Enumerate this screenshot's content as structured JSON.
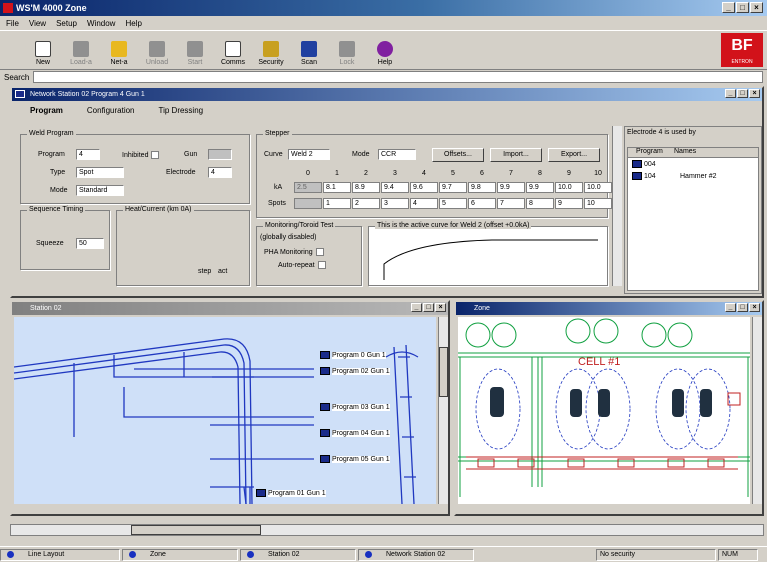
{
  "app": {
    "title": "WS'M 4000 Zone"
  },
  "menu": [
    "File",
    "View",
    "Setup",
    "Window",
    "Help"
  ],
  "toolbar": [
    {
      "label": "New",
      "enabled": true
    },
    {
      "label": "Load-a",
      "enabled": false
    },
    {
      "label": "Net-a",
      "enabled": true
    },
    {
      "label": "Unload",
      "enabled": false
    },
    {
      "label": "Start",
      "enabled": false
    },
    {
      "label": "Comms",
      "enabled": true
    },
    {
      "label": "Security",
      "enabled": true
    },
    {
      "label": "Scan",
      "enabled": true
    },
    {
      "label": "Lock",
      "enabled": false
    },
    {
      "label": "Help",
      "enabled": true
    }
  ],
  "logo": {
    "text": "BF",
    "sub": "ENTRON"
  },
  "search": {
    "label": "Search"
  },
  "network_window": {
    "title": "Network  Station 02 Program 4 Gun 1",
    "tabs": [
      "Program",
      "Configuration",
      "Tip Dressing"
    ],
    "weld_program": {
      "group_label": "Weld Program",
      "program_label": "Program",
      "program_value": "4",
      "inhibited_label": "Inhibited",
      "gun_label": "Gun",
      "type_label": "Type",
      "type_value": "Spot",
      "electrode_label": "Electrode",
      "electrode_value": "4",
      "mode_label": "Mode",
      "mode_value": "Standard"
    },
    "sequence": {
      "label": "Sequence Timing",
      "squeeze_label": "Squeeze",
      "squeeze_value": "50"
    },
    "heat": {
      "label": "Heat/Current (km 0A)",
      "step_label": "step",
      "act_label": "act"
    },
    "stepper": {
      "label": "Stepper",
      "curve_label": "Curve",
      "curve_value": "Weld 2",
      "mode_label": "Mode",
      "mode_value": "CCR",
      "offsets_btn": "Offsets...",
      "import_btn": "Import...",
      "export_btn": "Export...",
      "columns": [
        "0",
        "1",
        "2",
        "3",
        "4",
        "5",
        "6",
        "7",
        "8",
        "9",
        "10"
      ],
      "ka_label": "kA",
      "ka_values": [
        "2.5",
        "8.1",
        "8.9",
        "9.4",
        "9.6",
        "9.7",
        "9.8",
        "9.9",
        "9.9",
        "10.0",
        "10.0"
      ],
      "spots_label": "Spots",
      "spots_values": [
        "",
        "1",
        "2",
        "3",
        "4",
        "5",
        "6",
        "7",
        "8",
        "9",
        "10"
      ]
    },
    "monitoring": {
      "label": "Monitoring/Toroid Test",
      "sub": "(globally disabled)",
      "pha": "PHA Monitoring",
      "auto": "Auto-repeat"
    },
    "curve_note": "This is the active curve for Weld 2 (offset +0.0kA)"
  },
  "electrode_panel": {
    "title": "Electrode 4 is used by",
    "headers": [
      "Program",
      "Names"
    ],
    "rows": [
      {
        "program": "004",
        "name": ""
      },
      {
        "program": "104",
        "name": "Hammer #2"
      }
    ]
  },
  "station_window": {
    "title": "Station 02",
    "programs": [
      "Program 0 Gun 1",
      "Program 02 Gun 1",
      "Program 03 Gun 1",
      "Program 04 Gun 1",
      "Program 05 Gun 1",
      "Program 01 Gun 1"
    ]
  },
  "zone_window": {
    "title": "Zone",
    "cell_label": "CELL #1"
  },
  "taskbar": [
    "Line Layout",
    "Zone",
    "Station 02",
    "Network  Station 02"
  ],
  "status": {
    "security": "No security",
    "num": "NUM"
  },
  "colors": {
    "title_blue": "#0a246a",
    "logo_red": "#d2121a",
    "drawing_blue": "#2038c0"
  }
}
